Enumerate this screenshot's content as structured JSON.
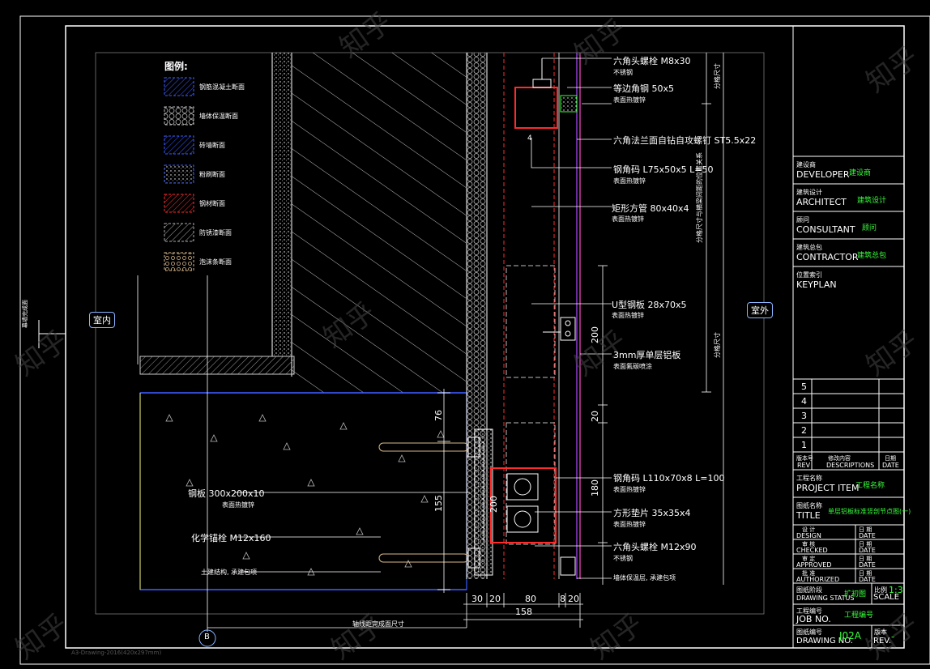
{
  "legend": {
    "title": "图例:",
    "items": [
      "钢筋混凝土断面",
      "墙体保温断面",
      "砖墙断面",
      "粉刷断面",
      "钢材断面",
      "防锈漆断面",
      "泡沫条断面"
    ]
  },
  "side_labels": {
    "indoor": "室内",
    "outdoor": "室外"
  },
  "left_vertical_text": "幕墙完成面",
  "annotations": {
    "bolt_m8": "六角头螺栓 M8x30",
    "bolt_m8_sub": "不锈钢",
    "flat_steel": "等边角钢 50x5",
    "flat_steel_sub": "表面热镀锌",
    "screw": "六角法兰面自钻自攻螺钉 ST5.5x22",
    "angle_75": "钢角码 L75x50x5 L=50",
    "angle_75_sub": "表面热镀锌",
    "tube": "矩形方管 80x40x4",
    "tube_sub": "表面热镀锌",
    "u_steel": "U型钢板 28x70x5",
    "u_steel_sub": "表面热镀锌",
    "al_panel": "3mm厚单层铝板",
    "al_panel_sub": "表面氟碳喷涂",
    "angle_110": "钢角码 L110x70x8 L=100",
    "angle_110_sub": "表面热镀锌",
    "washer": "方形垫片 35x35x4",
    "washer_sub": "表面热镀锌",
    "bolt_m12": "六角头螺栓 M12x90",
    "bolt_m12_sub": "不锈钢",
    "foam": "墙体保温层, 承建包项",
    "plate": "钢板 300x200x10",
    "plate_sub": "表面热镀锌",
    "chem_bolt": "化学锚栓 M12x160",
    "struct": "土建结构, 承建包项",
    "axis_text": "轴线距完成面尺寸",
    "vert_text1": "分格尺寸",
    "vert_text2": "分格尺寸与横梁间距的位置关系",
    "vert_text3": "分格尺寸"
  },
  "dimensions": {
    "d76": "76",
    "d155": "155",
    "d200a": "200",
    "d200b": "200",
    "d20": "20",
    "d180": "180",
    "bottom": [
      "30",
      "20",
      "80",
      "8",
      "20"
    ],
    "total": "158",
    "axis": "B"
  },
  "titleblock": {
    "developer_cn": "建设商",
    "developer": "DEVELOPER",
    "developer_val": "建设商",
    "architect_cn": "建筑设计",
    "architect": "ARCHITECT",
    "architect_val": "建筑设计",
    "consultant_cn": "顾问",
    "consultant": "CONSULTANT",
    "consultant_val": "顾问",
    "contractor_cn": "建筑总包",
    "contractor": "CONTRACTOR",
    "contractor_val": "建筑总包",
    "keyplan_cn": "位置索引",
    "keyplan": "KEYPLAN",
    "rev_rows": [
      "5",
      "4",
      "3",
      "2",
      "1"
    ],
    "rev_head": [
      "版本号",
      "修改内容",
      "日期"
    ],
    "rev_head_en": [
      "REV",
      "DESCRIPTIONS",
      "DATE"
    ],
    "project_cn": "工程名称",
    "project": "PROJECT ITEM",
    "project_val": "工程名称",
    "title_cn": "图纸名称",
    "title": "TITLE",
    "title_val": "单层铝板标准竖剖节点图(一)",
    "design": "DESIGN",
    "checked": "CHECKED",
    "approved": "APPROVED",
    "authorized": "AUTHORIZED",
    "date": "DATE",
    "design_cn": "设 计",
    "checked_cn": "审 核",
    "approved_cn": "审 定",
    "authorized_cn": "批 准",
    "date_cn": "日 期",
    "status_cn": "图纸阶段",
    "status": "DRAWING STATUS",
    "status_val": "扩初图",
    "scale_cn": "比例",
    "scale": "SCALE",
    "scale_val": "1:3",
    "job_cn": "工程编号",
    "job": "JOB NO.",
    "job_val": "工程编号",
    "drawing_cn": "图纸编号",
    "drawing": "DRAWING NO.",
    "drawing_val": "J02A",
    "revno_cn": "版本",
    "revno": "REV.",
    "revno_val": "-"
  },
  "footer_text": "A3-Drawing-2016(420x297mm)",
  "watermark": "知乎"
}
